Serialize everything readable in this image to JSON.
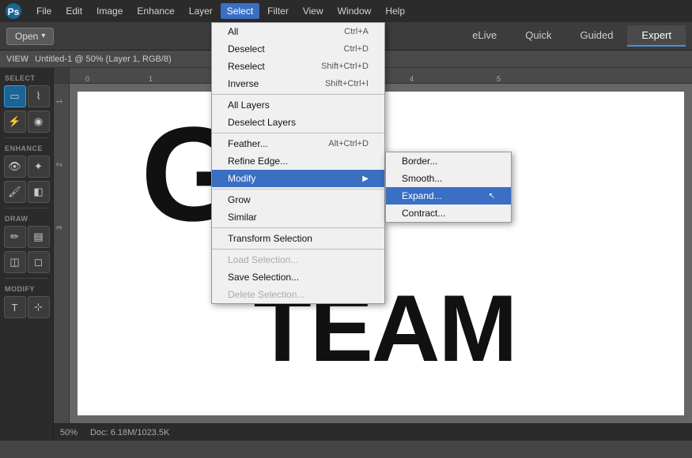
{
  "app": {
    "title": "Adobe Photoshop Elements"
  },
  "menubar": {
    "items": [
      "File",
      "Edit",
      "Image",
      "Enhance",
      "Layer",
      "Select",
      "Filter",
      "View",
      "Window",
      "Help"
    ],
    "active": "Select"
  },
  "toolbar": {
    "open_label": "Open",
    "open_arrow": "▾"
  },
  "mode_tabs": {
    "items": [
      "eLive",
      "Quick",
      "Guided",
      "Expert"
    ],
    "active": "Expert"
  },
  "sub_toolbar": {
    "view_label": "VIEW",
    "doc_title": "Untitled-1 @ 50% (Layer 1, RGB/8)"
  },
  "select_menu": {
    "items": [
      {
        "label": "All",
        "shortcut": "Ctrl+A",
        "disabled": false
      },
      {
        "label": "Deselect",
        "shortcut": "Ctrl+D",
        "disabled": false
      },
      {
        "label": "Reselect",
        "shortcut": "Shift+Ctrl+D",
        "disabled": false
      },
      {
        "label": "Inverse",
        "shortcut": "Shift+Ctrl+I",
        "disabled": false
      },
      {
        "divider": true
      },
      {
        "label": "All Layers",
        "shortcut": "",
        "disabled": false
      },
      {
        "label": "Deselect Layers",
        "shortcut": "",
        "disabled": false
      },
      {
        "divider": true
      },
      {
        "label": "Feather...",
        "shortcut": "Alt+Ctrl+D",
        "disabled": false
      },
      {
        "label": "Refine Edge...",
        "shortcut": "",
        "disabled": false
      },
      {
        "label": "Modify",
        "shortcut": "",
        "has_submenu": true,
        "highlighted": true
      },
      {
        "divider": true
      },
      {
        "label": "Grow",
        "shortcut": "",
        "disabled": false
      },
      {
        "label": "Similar",
        "shortcut": "",
        "disabled": false
      },
      {
        "divider": true
      },
      {
        "label": "Transform Selection",
        "shortcut": "",
        "disabled": false
      },
      {
        "divider": true
      },
      {
        "label": "Load Selection...",
        "shortcut": "",
        "disabled": true
      },
      {
        "label": "Save Selection...",
        "shortcut": "",
        "disabled": false
      },
      {
        "label": "Delete Selection...",
        "shortcut": "",
        "disabled": true
      }
    ]
  },
  "modify_submenu": {
    "items": [
      {
        "label": "Border...",
        "shortcut": ""
      },
      {
        "label": "Smooth...",
        "shortcut": ""
      },
      {
        "label": "Expand...",
        "shortcut": "",
        "highlighted": true
      },
      {
        "label": "Contract...",
        "shortcut": ""
      }
    ]
  },
  "canvas": {
    "go_text": "GO",
    "team_text": "TEAM"
  },
  "status_bar": {
    "zoom": "50%",
    "doc_size": "Doc: 6.18M/1023.5K"
  },
  "tools": {
    "select_section": "SELECT",
    "draw_section": "DRAW",
    "modify_section": "MODIFY",
    "enhance_section": "ENHANCE"
  }
}
